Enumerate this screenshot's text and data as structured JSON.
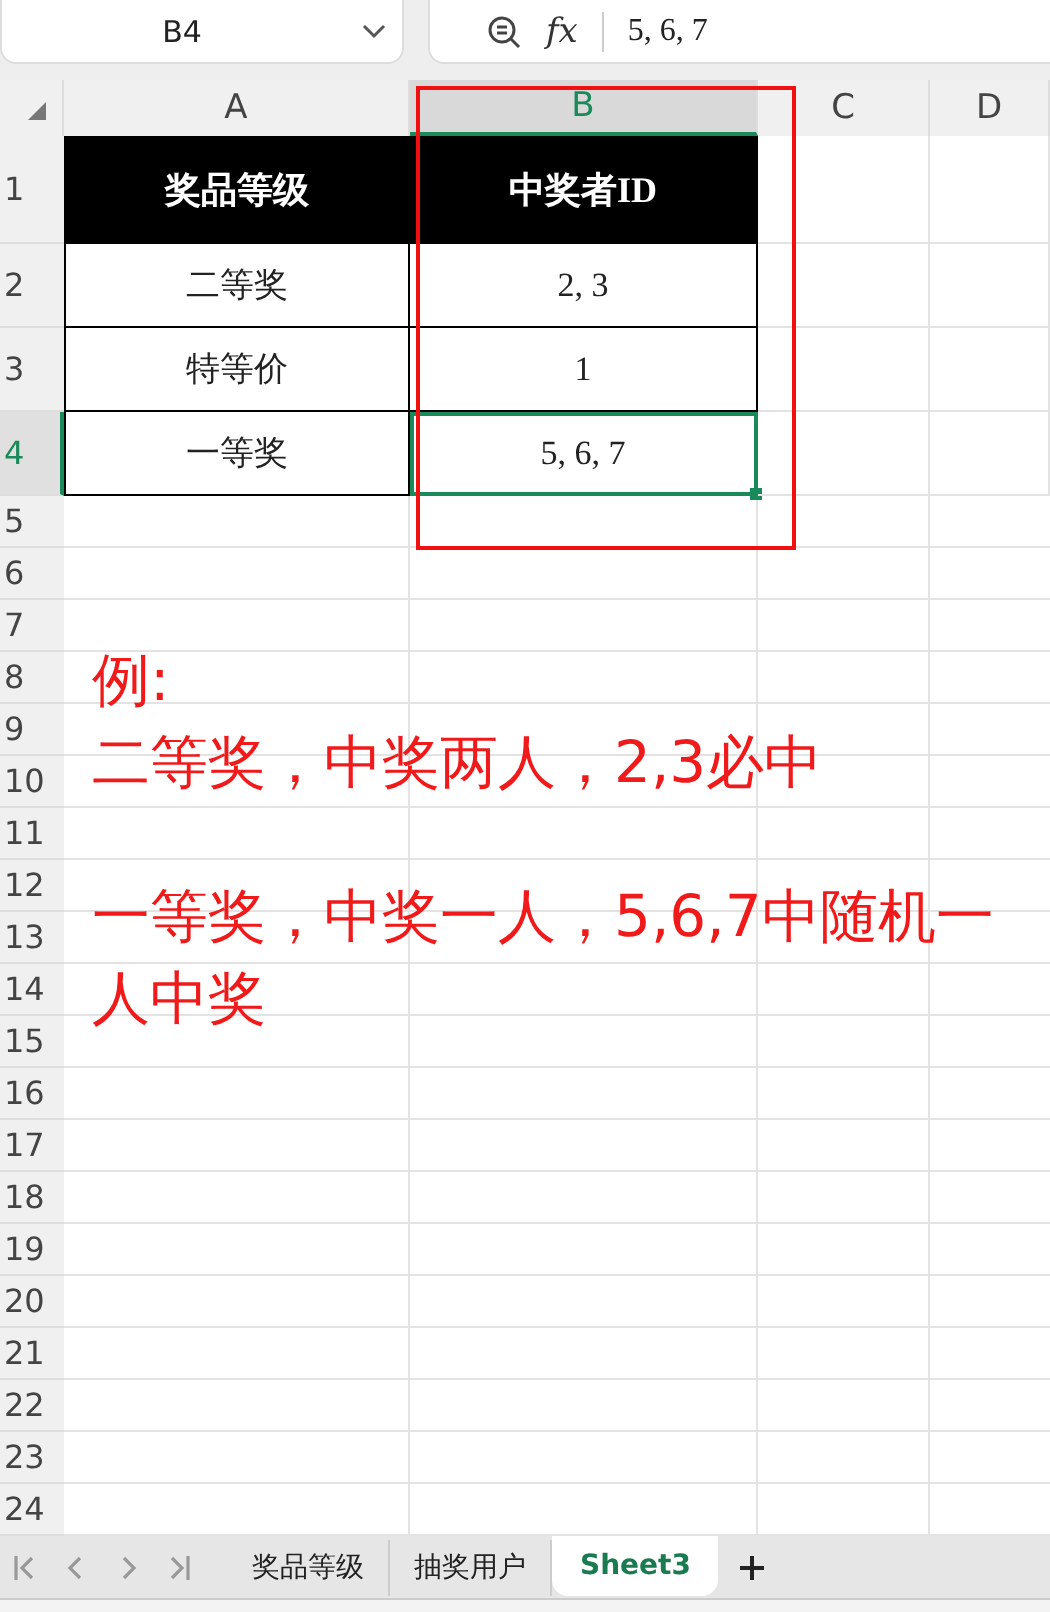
{
  "formula_bar": {
    "name_box": "B4",
    "fx": "fx",
    "value": "5, 6, 7"
  },
  "columns": [
    {
      "label": "A",
      "selected": false
    },
    {
      "label": "B",
      "selected": true
    },
    {
      "label": "C",
      "selected": false
    },
    {
      "label": "D",
      "selected": false
    }
  ],
  "rows": [
    {
      "label": "1",
      "selected": false,
      "kind": "header",
      "cells": [
        {
          "text": "奖品等级",
          "selected": false
        },
        {
          "text": "中奖者ID",
          "selected": false
        }
      ]
    },
    {
      "label": "2",
      "selected": false,
      "kind": "data",
      "cells": [
        {
          "text": "二等奖",
          "selected": false
        },
        {
          "text": "2, 3",
          "selected": false
        }
      ]
    },
    {
      "label": "3",
      "selected": false,
      "kind": "data",
      "cells": [
        {
          "text": "特等价",
          "selected": false
        },
        {
          "text": "1",
          "selected": false
        }
      ]
    },
    {
      "label": "4",
      "selected": true,
      "kind": "data",
      "cells": [
        {
          "text": "一等奖",
          "selected": false
        },
        {
          "text": "5, 6, 7",
          "selected": true
        }
      ]
    },
    {
      "label": "5",
      "selected": false,
      "kind": "empty"
    },
    {
      "label": "6",
      "selected": false,
      "kind": "empty"
    },
    {
      "label": "7",
      "selected": false,
      "kind": "empty"
    },
    {
      "label": "8",
      "selected": false,
      "kind": "empty"
    },
    {
      "label": "9",
      "selected": false,
      "kind": "empty"
    },
    {
      "label": "10",
      "selected": false,
      "kind": "empty"
    },
    {
      "label": "11",
      "selected": false,
      "kind": "empty"
    },
    {
      "label": "12",
      "selected": false,
      "kind": "empty"
    },
    {
      "label": "13",
      "selected": false,
      "kind": "empty"
    },
    {
      "label": "14",
      "selected": false,
      "kind": "empty"
    },
    {
      "label": "15",
      "selected": false,
      "kind": "empty"
    },
    {
      "label": "16",
      "selected": false,
      "kind": "empty"
    },
    {
      "label": "17",
      "selected": false,
      "kind": "empty"
    },
    {
      "label": "18",
      "selected": false,
      "kind": "empty"
    },
    {
      "label": "19",
      "selected": false,
      "kind": "empty"
    },
    {
      "label": "20",
      "selected": false,
      "kind": "empty"
    },
    {
      "label": "21",
      "selected": false,
      "kind": "empty"
    },
    {
      "label": "22",
      "selected": false,
      "kind": "empty"
    },
    {
      "label": "23",
      "selected": false,
      "kind": "empty"
    },
    {
      "label": "24",
      "selected": false,
      "kind": "empty"
    }
  ],
  "note": {
    "paragraphs": [
      "例:\n二等奖，中奖两人，2,3必中",
      "一等奖，中奖一人，5,6,7中随机一人中奖"
    ]
  },
  "sheet_tabs": [
    {
      "label": "奖品等级",
      "selected": false
    },
    {
      "label": "抽奖用户",
      "selected": false
    },
    {
      "label": "Sheet3",
      "selected": true
    }
  ]
}
